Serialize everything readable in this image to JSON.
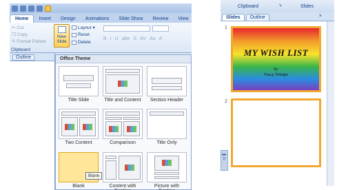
{
  "left": {
    "tabs": [
      "Home",
      "Insert",
      "Design",
      "Animations",
      "Slide Show",
      "Review",
      "View"
    ],
    "clipboard": {
      "cut": "Cut",
      "copy": "Copy",
      "format_painter": "Format Painter",
      "group_label": "Clipboard"
    },
    "new_slide": "New Slide",
    "slide_cmds": {
      "layout": "Layout",
      "reset": "Reset",
      "delete": "Delete"
    },
    "format_buttons": [
      "B",
      "I",
      "U",
      "abe",
      "S",
      "AV",
      "Aa",
      "A"
    ],
    "outline_tab": "Outline",
    "gallery_title": "Office Theme",
    "layouts": [
      {
        "name": "Title Slide"
      },
      {
        "name": "Title and Content"
      },
      {
        "name": "Section Header"
      },
      {
        "name": "Two Content"
      },
      {
        "name": "Comparison"
      },
      {
        "name": "Title Only"
      },
      {
        "name": "Blank"
      },
      {
        "name": "Content with Caption"
      },
      {
        "name": "Picture with Caption"
      }
    ],
    "tooltip": "Blank"
  },
  "right": {
    "ribbon": {
      "clipboard": "Clipboard",
      "slides": "Slides"
    },
    "pane_tabs": [
      "Slides",
      "Outline"
    ],
    "close": "×",
    "slide1": {
      "number": "1",
      "title": "MY WISH LIST",
      "by": "by",
      "author": "Tracy Trimpe"
    },
    "slide2": {
      "number": "2"
    }
  },
  "colors": {
    "ribbon_blue": "#bfd3ee",
    "selection_orange": "#f0a830",
    "accent_text": "#15428b"
  }
}
